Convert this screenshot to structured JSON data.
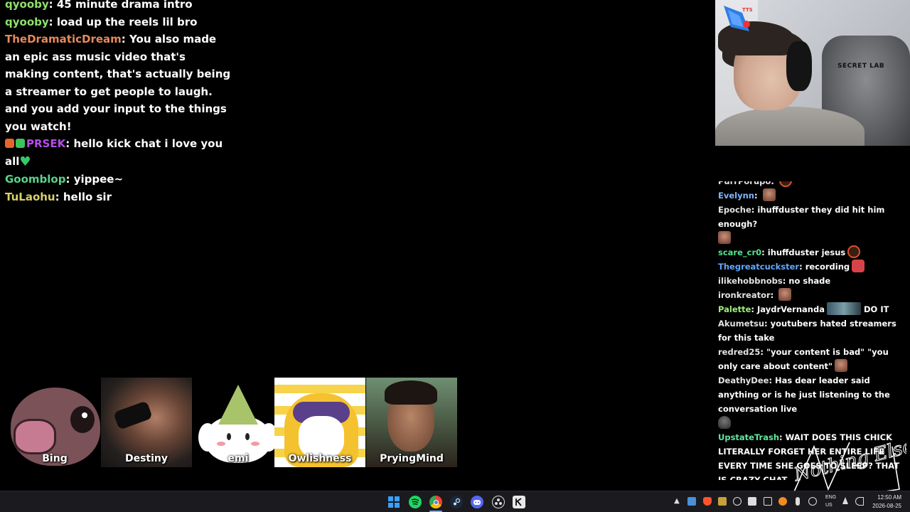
{
  "left_chat": [
    {
      "user": "qyooby",
      "color": "#8ee36b",
      "text": "45 minute drama intro"
    },
    {
      "user": "qyooby",
      "color": "#8ee36b",
      "text": "load up the reels lil bro"
    },
    {
      "user": "TheDramaticDream",
      "color": "#e58a5c",
      "text": "You also made an epic ass music video that's making content, that's actually being a streamer to get people to laugh. and you add your input to the things you watch!"
    },
    {
      "user": "PRSEK",
      "color": "#b64de8",
      "text": "hello kick chat i love you all",
      "badges": [
        "#e8652a",
        "#3cc35a"
      ],
      "emote": "green-heart"
    },
    {
      "user": "Goomblop",
      "color": "#59d38c",
      "text": "yippee~"
    },
    {
      "user": "TuLaohu",
      "color": "#d8d06a",
      "text": "hello sir"
    }
  ],
  "right_chat": [
    {
      "user": "PurrPorupo",
      "color": "#e2e2e2",
      "text": "",
      "emote": "round"
    },
    {
      "user": "Evelynn",
      "color": "#7db7ff",
      "text": "",
      "emote": "face"
    },
    {
      "user": "Epoche",
      "color": "#e2e2e2",
      "text": "ihuffduster they did hit him enough?",
      "emote_after": "face"
    },
    {
      "user": "scare_cr0",
      "color": "#54e38e",
      "text": "ihuffduster jesus",
      "emote": "round"
    },
    {
      "user": "Thegreatcuckster",
      "color": "#61a6ff",
      "text": "recording",
      "emote": "red"
    },
    {
      "user": "ilikehobbnobs",
      "color": "#e2e2e2",
      "text": "no shade"
    },
    {
      "user": "ironkreator",
      "color": "#e2e2e2",
      "text": "",
      "emote": "face"
    },
    {
      "user": "Palette",
      "color": "#9ff07a",
      "text": "JaydrVernanda",
      "emote": "wide",
      "text_after": "DO IT"
    },
    {
      "user": "Akumetsu",
      "color": "#e2e2e2",
      "text": "youtubers hated streamers for this take"
    },
    {
      "user": "redred25",
      "color": "#e2e2e2",
      "text": "\"your content is bad\" \"you only care about content\"",
      "emote": "face"
    },
    {
      "user": "DeathyDee",
      "color": "#e2e2e2",
      "text": "Has dear leader said anything or is he just listening to the conversation live",
      "emote_after": "helm"
    },
    {
      "user": "UpstateTrash",
      "color": "#63e6a0",
      "text": "WAIT DOES THIS CHICK LITERALLY FORGET HER ENTIRE LIFE EVERY TIME SHE GOES TO SLEEP? THAT IS CRAZY CHAT"
    }
  ],
  "voice_participants": [
    "Bing",
    "Destiny",
    "emi",
    "Owlishness",
    "PryingMind"
  ],
  "webcam": {
    "chair_brand": "SECRET LAB",
    "tts_label": "TTS ON"
  },
  "logo_text": "Nothing Else?",
  "taskbar": {
    "apps": [
      "windows-start",
      "spotify",
      "chrome",
      "steam",
      "discord",
      "obs",
      "kick"
    ],
    "lang_top": "ENG",
    "lang_bottom": "US",
    "time": "12:50 AM",
    "date": "2026-08-25"
  }
}
